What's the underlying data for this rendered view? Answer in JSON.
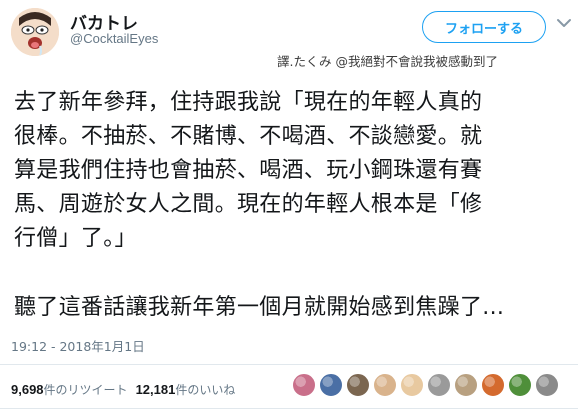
{
  "author": {
    "display_name": "バカトレ",
    "handle": "@CocktailEyes",
    "avatar_icon": "drooling-face-avatar"
  },
  "header": {
    "follow_label": "フォローする",
    "menu_icon": "chevron-down-icon",
    "accent_color": "#1da1f2"
  },
  "translation_credit": "譯.たくみ @我絕對不會說我被感動到了",
  "tweet": {
    "lines": [
      "去了新年參拜，住持跟我說「現在的年輕人真的",
      "很棒。不抽菸、不賭博、不喝酒、不談戀愛。就",
      "算是我們住持也會抽菸、喝酒、玩小鋼珠還有賽",
      "馬、周遊於女人之間。現在的年輕人根本是「修",
      "行僧」了。」",
      "",
      "聽了這番話讓我新年第一個月就開始感到焦躁了..."
    ],
    "timestamp": "19:12 - 2018年1月1日"
  },
  "stats": {
    "retweets_count": "9,698",
    "retweets_label": "件のリツイート",
    "likes_count": "12,181",
    "likes_label": "件のいいね"
  },
  "liker_avatars": [
    {
      "icon": "colorful-illustration-avatar",
      "color": "#c96f8a"
    },
    {
      "icon": "anime-character-avatar",
      "color": "#4a6fa5"
    },
    {
      "icon": "photo-avatar",
      "color": "#7b6650"
    },
    {
      "icon": "anime-girl-avatar",
      "color": "#d9b38c"
    },
    {
      "icon": "anime-character-avatar",
      "color": "#e8c9a0"
    },
    {
      "icon": "sketch-avatar",
      "color": "#9a9a9a"
    },
    {
      "icon": "cat-avatar",
      "color": "#b8a080"
    },
    {
      "icon": "colorful-illustration-avatar",
      "color": "#d46a2e"
    },
    {
      "icon": "green-character-avatar",
      "color": "#4f8f3a"
    },
    {
      "icon": "sketch-avatar",
      "color": "#8a8a8a"
    }
  ]
}
